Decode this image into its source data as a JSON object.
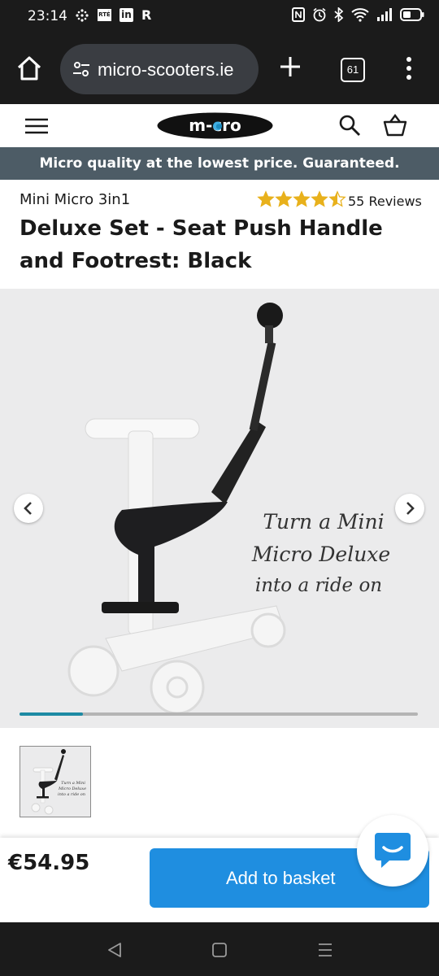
{
  "status": {
    "time": "23:14",
    "notif_icons": [
      "hash-grid-icon",
      "rte-icon",
      "linkedin-icon",
      "r-icon"
    ],
    "right_icons": [
      "nfc-icon",
      "alarm-icon",
      "bluetooth-icon",
      "wifi-icon",
      "signal-icon",
      "battery-icon"
    ],
    "rte_label": "RTÉ",
    "r_label": "R",
    "linkedin_label": "in"
  },
  "browser": {
    "url": "micro-scooters.ie",
    "tab_count": "61"
  },
  "site": {
    "logo_text": "m-cro",
    "promo": "Micro quality at the lowest price. Guaranteed."
  },
  "product": {
    "subtitle": "Mini Micro 3in1",
    "rating_stars": 4.5,
    "reviews": "55 Reviews",
    "title": "Deluxe Set - Seat Push Handle and Footrest: Black",
    "image_caption": [
      "Turn a Mini",
      "Micro Deluxe",
      "into a ride on"
    ],
    "thumb_caption": [
      "Turn a Mini",
      "Micro Deluxe",
      "into a ride on"
    ],
    "gallery_progress": 0.16,
    "price": "€54.95",
    "add_label": "Add to basket"
  },
  "colors": {
    "accent": "#1f8ee0",
    "promo_bg": "#4d5c66",
    "star": "#e8b11c",
    "scroll": "#1d8aa3"
  }
}
